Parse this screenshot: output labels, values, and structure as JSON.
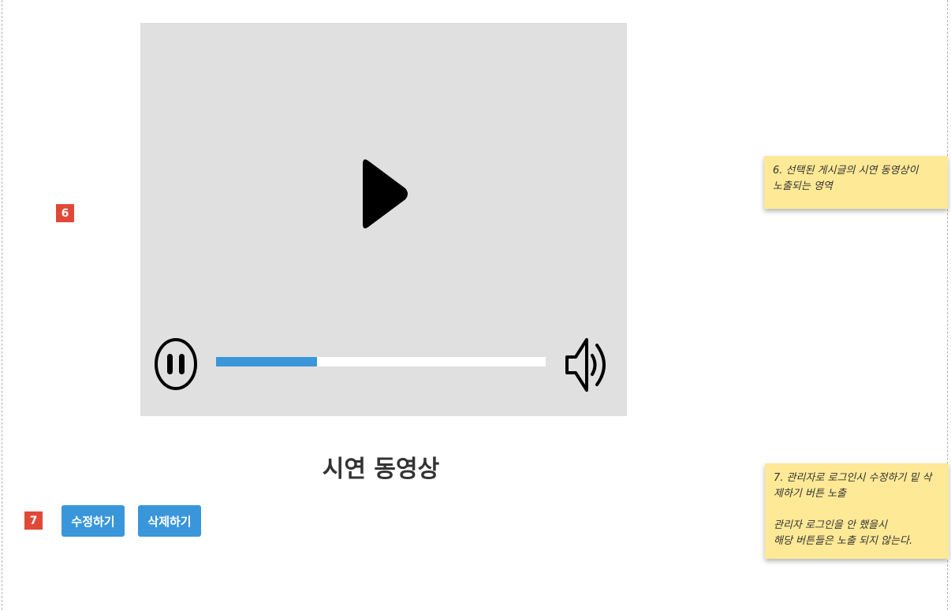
{
  "annotations": {
    "badge_6": "6",
    "badge_7": "7",
    "note_6": "6. 선택된 게시글의 시연 동영상이\n노출되는 영역",
    "note_7_line1": "7. 관리자로 로그인시 수정하기 밑  삭\n제하기 버튼 노출",
    "note_7_line2": "관리자 로그인을 안 했을시\n해당 버튼들은 노출 되지 않는다."
  },
  "video": {
    "icons": {
      "play": "play-icon",
      "pause": "pause-icon",
      "volume": "volume-icon"
    },
    "progress_fraction": 0.306,
    "colors": {
      "player_bg": "#e0e0e0",
      "progress_fill": "#3a96db",
      "progress_track": "#ffffff"
    }
  },
  "content": {
    "title": "시연 동영상"
  },
  "actions": {
    "edit_label": "수정하기",
    "delete_label": "삭제하기",
    "button_color": "#3a96db"
  },
  "colors": {
    "badge": "#e04838",
    "sticky_note": "#fde996"
  }
}
